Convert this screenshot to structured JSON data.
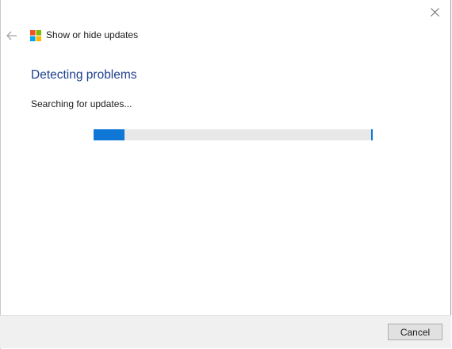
{
  "window": {
    "app_title": "Show or hide updates",
    "close_icon": "close-icon",
    "back_icon": "back-arrow-icon",
    "logo_icon": "windows-logo-icon"
  },
  "main": {
    "heading": "Detecting problems",
    "status": "Searching for updates...",
    "progress_fraction": 0.11
  },
  "footer": {
    "cancel_label": "Cancel"
  },
  "colors": {
    "heading": "#1e3f8f",
    "progress_fill": "#0f78d6",
    "progress_track": "#e8e8e8",
    "footer_bg": "#f0f0f0",
    "logo_red": "#f25022",
    "logo_green": "#7fba00",
    "logo_blue": "#00a4ef",
    "logo_yellow": "#ffb900"
  }
}
